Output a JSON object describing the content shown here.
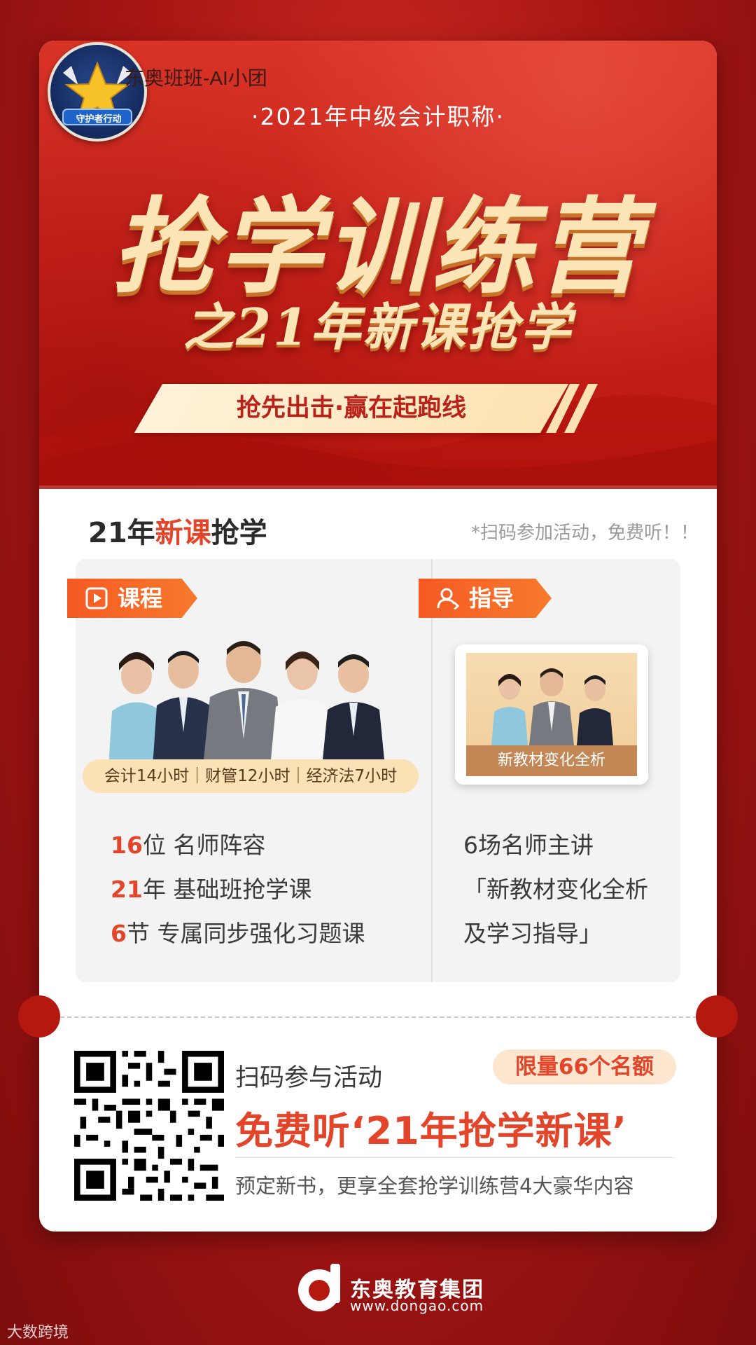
{
  "badge": {
    "icon": "star-shield-badge-icon",
    "label": "守护者行动"
  },
  "watermark": "东奥班班-AI小团",
  "hero": {
    "subtitle": "·2021年中级会计职称·",
    "title": "抢学训练营",
    "title2": "之21年新课抢学",
    "slogan": "抢先出击·赢在起跑线"
  },
  "section": {
    "title_prefix": "21年",
    "title_highlight": "新课",
    "title_suffix": "抢学",
    "note": "*扫码参加活动，免费听！！"
  },
  "course": {
    "tag": "课程",
    "tag_icon": "play-icon",
    "hours": "会计14小时｜财管12小时｜经济法7小时",
    "features": [
      {
        "num": "16",
        "unit": "位",
        "text": " 名师阵容"
      },
      {
        "num": "21",
        "unit": "年",
        "text": " 基础班抢学课"
      },
      {
        "num": "6",
        "unit": "节",
        "text": " 专属同步强化习题课"
      }
    ]
  },
  "guide": {
    "tag": "指导",
    "tag_icon": "user-icon",
    "tablet_caption": "新教材变化全析",
    "lines": [
      "6场名师主讲",
      "「新教材变化全析",
      "及学习指导」"
    ]
  },
  "signup": {
    "scan_text": "扫码参与活动",
    "limit": "限量66个名额",
    "free": "免费听‘21年抢学新课’",
    "sub": "预定新书，更享全套抢学训练营4大豪华内容"
  },
  "footer": {
    "brand": "东奥教育集团",
    "url": "www.dongao.com",
    "corner": "大数跨境"
  },
  "colors": {
    "accent": "#e2452a",
    "gold": "#fbe5b6",
    "hero_red": "#c92219"
  }
}
